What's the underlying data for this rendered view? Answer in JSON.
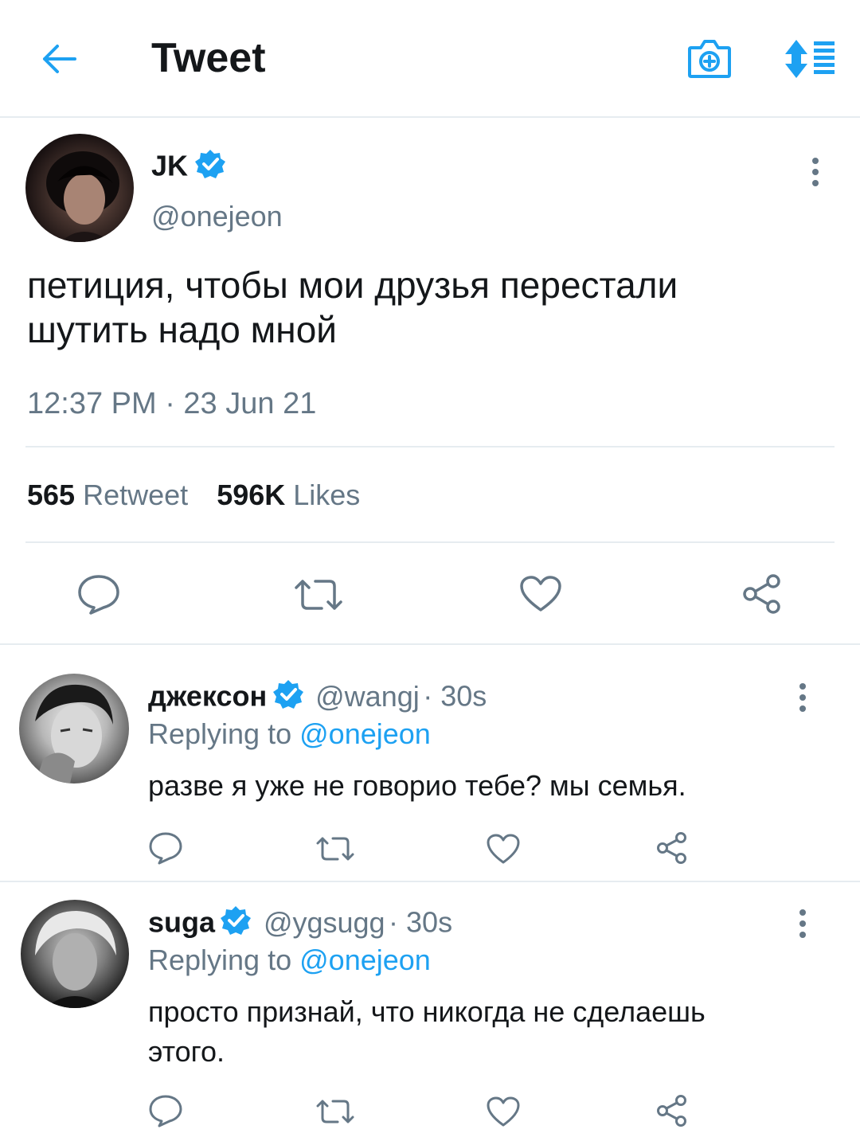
{
  "header": {
    "title": "Tweet",
    "back_icon": "back-arrow-icon",
    "camera_icon": "camera-add-icon",
    "sort_icon": "sort-icon",
    "accent": "#1da1f2"
  },
  "main_tweet": {
    "name": "JK",
    "handle": "@onejeon",
    "text_line1": "петиция, чтобы мои друзья перестали",
    "text_line2": "шутить надо мной",
    "time": "12:37 PM · 23 Jun 21",
    "retweet_count": "565",
    "retweet_label": "Retweet",
    "likes_count": "596K",
    "likes_label": "Likes"
  },
  "replies": [
    {
      "name": "джексон",
      "handle": "@wangj",
      "age": "· 30s",
      "replying_prefix": "Replying to",
      "replying_to": "@onejeon",
      "text_line1": "разве я уже не говорио тебе? мы семья.",
      "text_line2": ""
    },
    {
      "name": "suga",
      "handle": "@ygsugg",
      "age": "· 30s",
      "replying_prefix": "Replying to",
      "replying_to": "@onejeon",
      "text_line1": "просто признай, что никогда не сделаешь",
      "text_line2": "этого."
    }
  ],
  "colors": {
    "text": "#14171a",
    "secondary": "#657786",
    "divider": "#e6ecf0"
  }
}
